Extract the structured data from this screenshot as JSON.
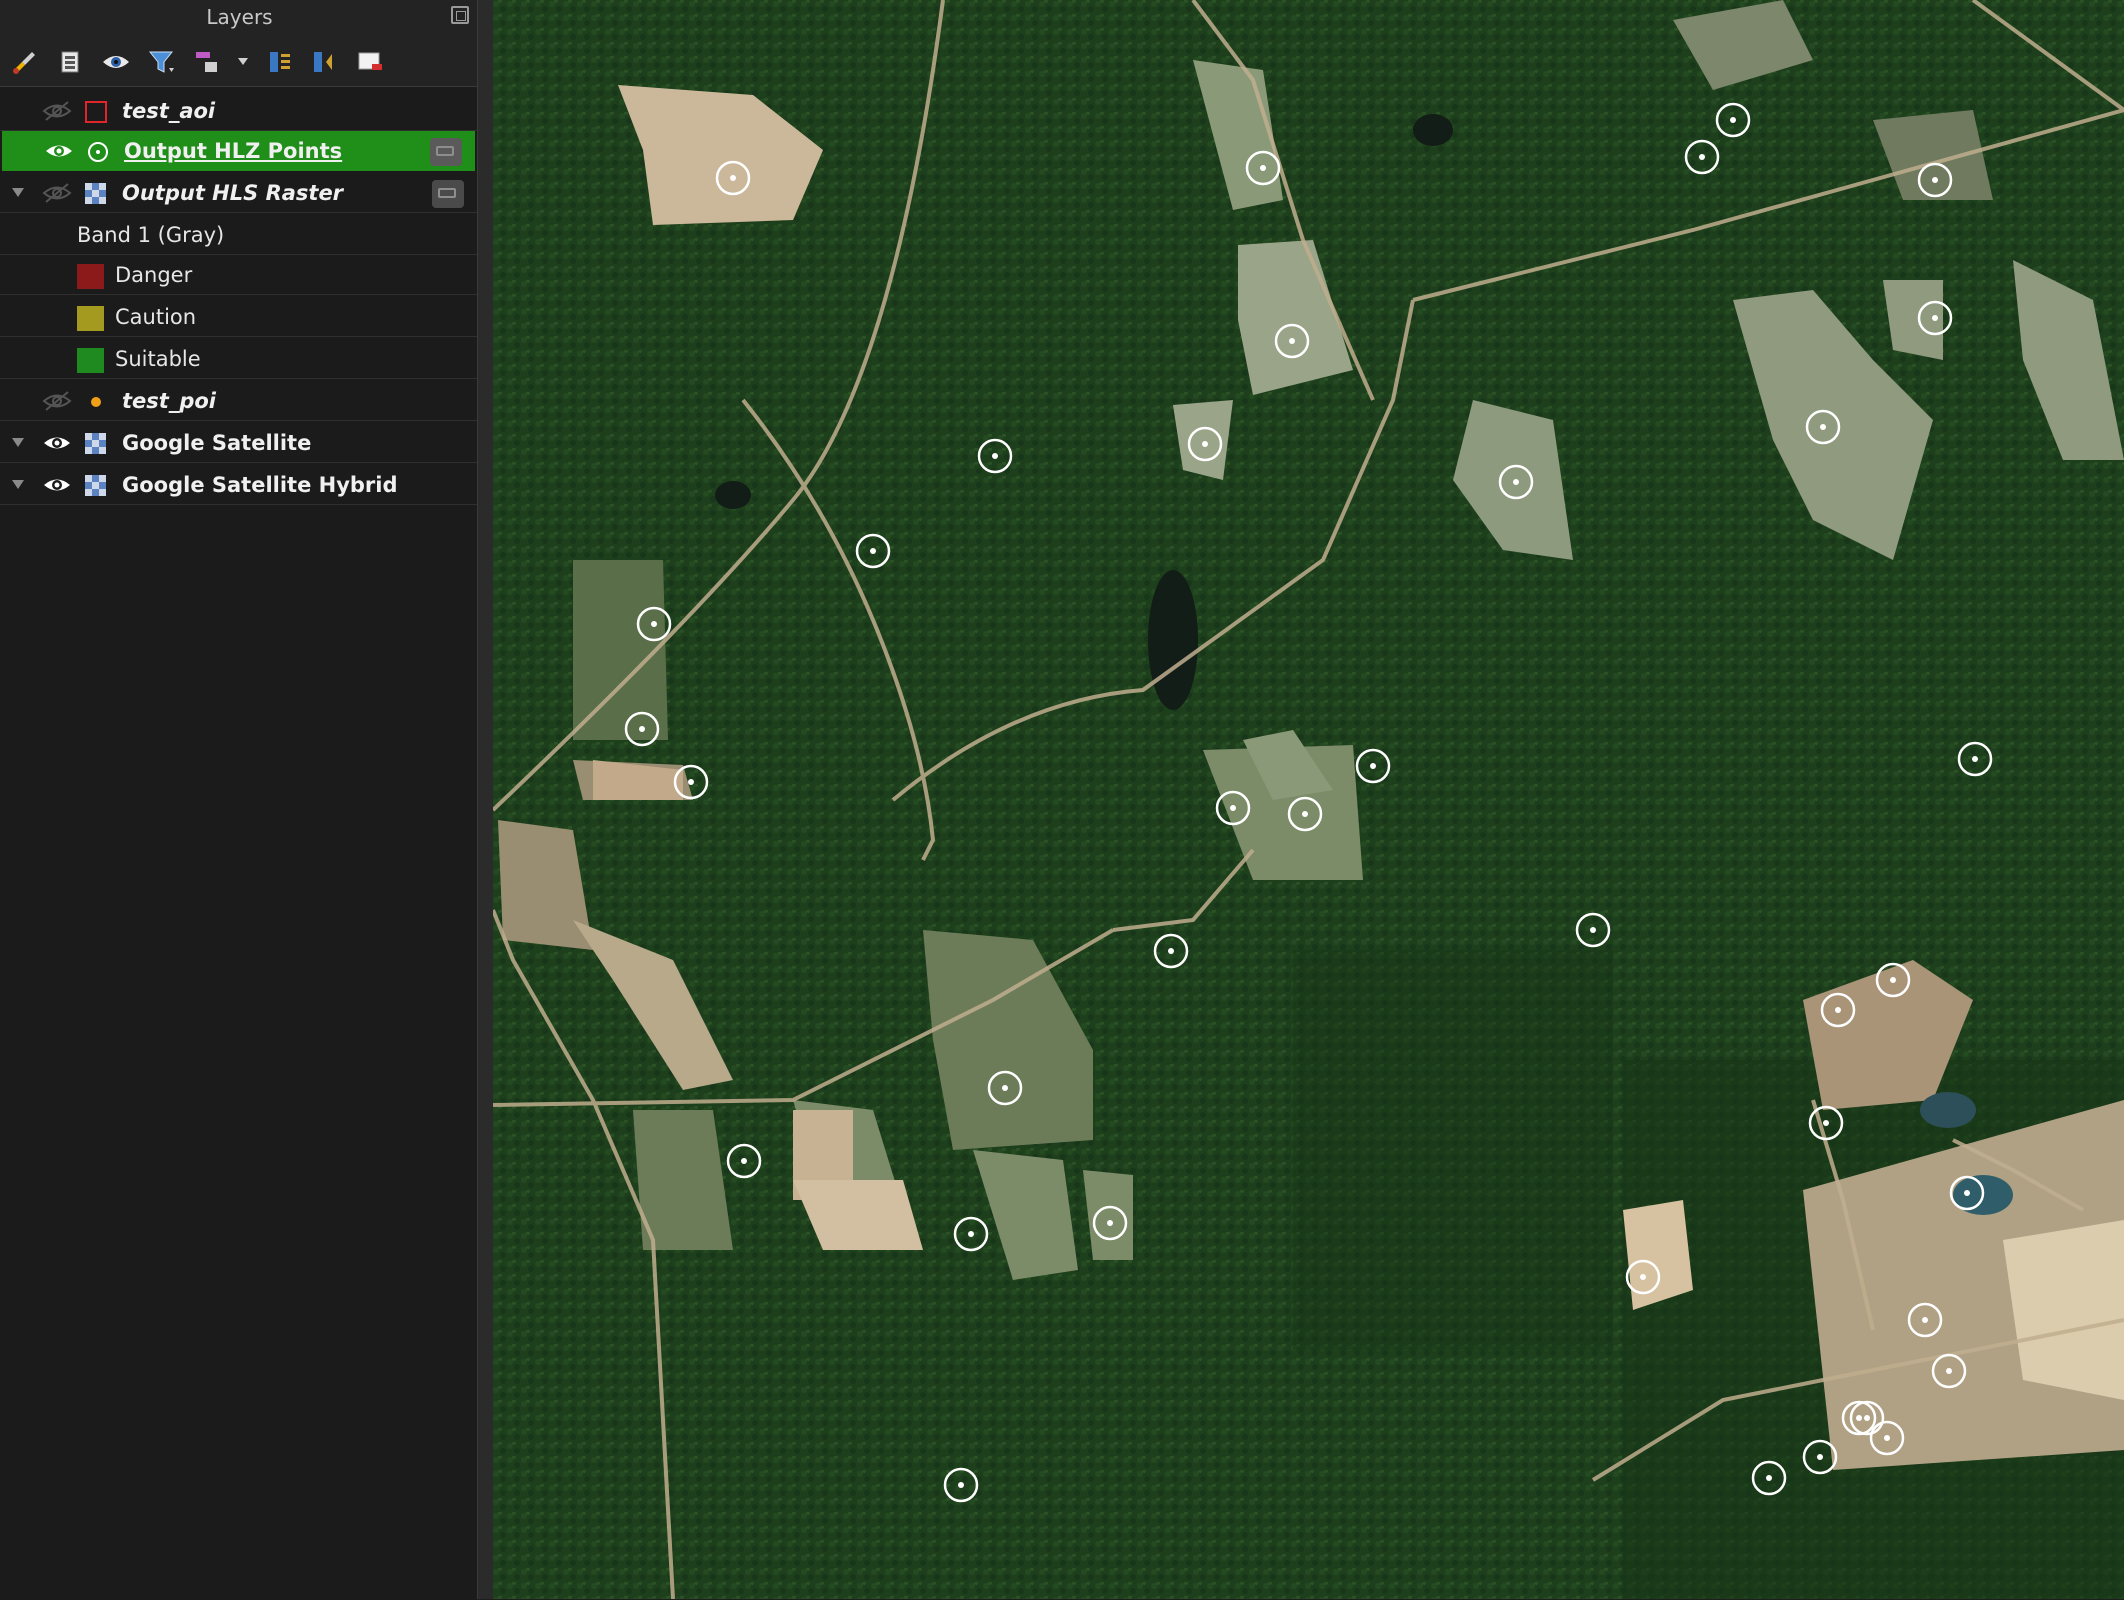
{
  "panel": {
    "title": "Layers"
  },
  "toolbar": {
    "buttons": [
      {
        "name": "style-manager-icon"
      },
      {
        "name": "add-group-icon"
      },
      {
        "name": "manage-visibility-icon"
      },
      {
        "name": "filter-legend-icon"
      },
      {
        "name": "filter-expression-icon"
      },
      {
        "name": "expand-all-icon"
      },
      {
        "name": "collapse-all-icon"
      },
      {
        "name": "remove-layer-icon"
      }
    ]
  },
  "layers": [
    {
      "name": "test_aoi",
      "visible": false,
      "icon": "polygon-icon",
      "italic": true,
      "selected": false
    },
    {
      "name": "Output HLZ Points",
      "visible": true,
      "icon": "point-icon",
      "italic": false,
      "selected": true,
      "embedded": true
    },
    {
      "name": "Output HLS Raster",
      "visible": false,
      "icon": "raster-icon",
      "italic": true,
      "selected": false,
      "embedded": true,
      "expanded": true,
      "band": "Band 1 (Gray)",
      "legend": [
        {
          "label": "Danger",
          "color": "#8c1a1a"
        },
        {
          "label": "Caution",
          "color": "#a39a1f"
        },
        {
          "label": "Suitable",
          "color": "#1f8a1f"
        }
      ]
    },
    {
      "name": "test_poi",
      "visible": false,
      "icon": "poi-dot-icon",
      "italic": true,
      "selected": false
    },
    {
      "name": "Google Satellite",
      "visible": true,
      "icon": "raster-icon",
      "italic": false,
      "selected": false,
      "expanded": true
    },
    {
      "name": "Google Satellite Hybrid",
      "visible": true,
      "icon": "raster-icon",
      "italic": false,
      "selected": false,
      "expanded": true
    }
  ],
  "map": {
    "hlz_point_count": 38,
    "colors": {
      "forest": "#1e3f1c",
      "forest_dark": "#173417",
      "clearing": "#c9b79a",
      "field": "#6c8a5a",
      "road": "#bfae8e",
      "point": "#ffffff",
      "selection": "#1f8f1a",
      "danger": "#8c1a1a",
      "caution": "#a39a1f",
      "suitable": "#1f8a1f"
    }
  }
}
